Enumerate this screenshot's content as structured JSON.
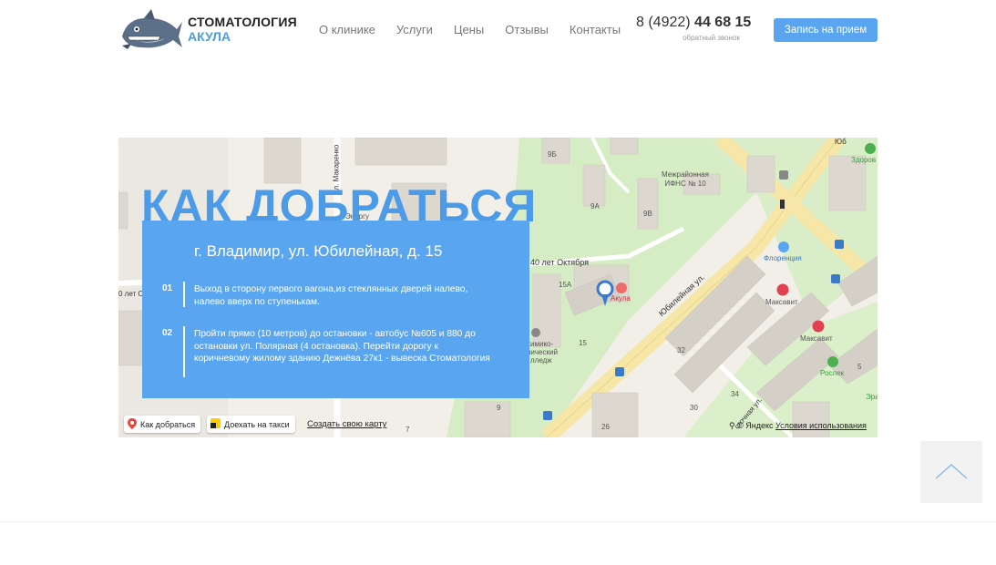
{
  "brand": {
    "line1": "СТОМАТОЛОГИЯ",
    "line2": "АКУЛА"
  },
  "nav": [
    "О клинике",
    "Услуги",
    "Цены",
    "Отзывы",
    "Контакты"
  ],
  "phone": {
    "prefix": "8 (4922) ",
    "number": "44 68 15",
    "caption": "обратный звонок"
  },
  "cta_label": "Запись на прием",
  "section": {
    "title": "КАК ДОБРАТЬСЯ",
    "address": "г. Владимир, ул. Юбилейная, д. 15",
    "steps": [
      {
        "num": "01",
        "text": "Выход в сторону первого вагона,из стеклянных дверей налево, налево вверх по ступенькам."
      },
      {
        "num": "02",
        "text": "Пройти прямо (10 метров) до остановки - автобус №605 и 880 до остановки ул. Полярная (4 остановка). Перейти дорогу к коричневому жилому зданию Дежнёва 27к1 - вывеска Стоматология"
      }
    ]
  },
  "map": {
    "route_button": "Как добраться",
    "taxi_button": "Доехать на такси",
    "create_link": "Создать свою карту",
    "copyright": "© Яндекс",
    "terms": "Условия использования",
    "labels": {
      "street1": "Юбилейная ул.",
      "street2": "40 лет Октября",
      "street3": "ул. Макаренко",
      "street4": "сточная ул.",
      "street5": "0 лет О",
      "street6": "Юб",
      "poi_tax": "Межрайонная ИФНС № 10",
      "poi_clinic": "Акула",
      "poi_florence": "Флоренция",
      "poi_maxavit1": "Максавит",
      "poi_maxavit2": "Максавит",
      "poi_zdorov": "Здоров",
      "poi_roslek": "Рослек",
      "poi_era": "Эра",
      "poi_college1": "химико-",
      "poi_college2": "нический",
      "poi_college3": "лледж",
      "poi_energy": "Энергу",
      "h9b": "9Б",
      "h9a": "9А",
      "h9v": "9В",
      "h15a": "15А",
      "h15": "15",
      "h32": "32",
      "h30": "30",
      "h34": "34",
      "h5": "5",
      "h9": "9",
      "h26": "26",
      "h7": "7"
    }
  }
}
